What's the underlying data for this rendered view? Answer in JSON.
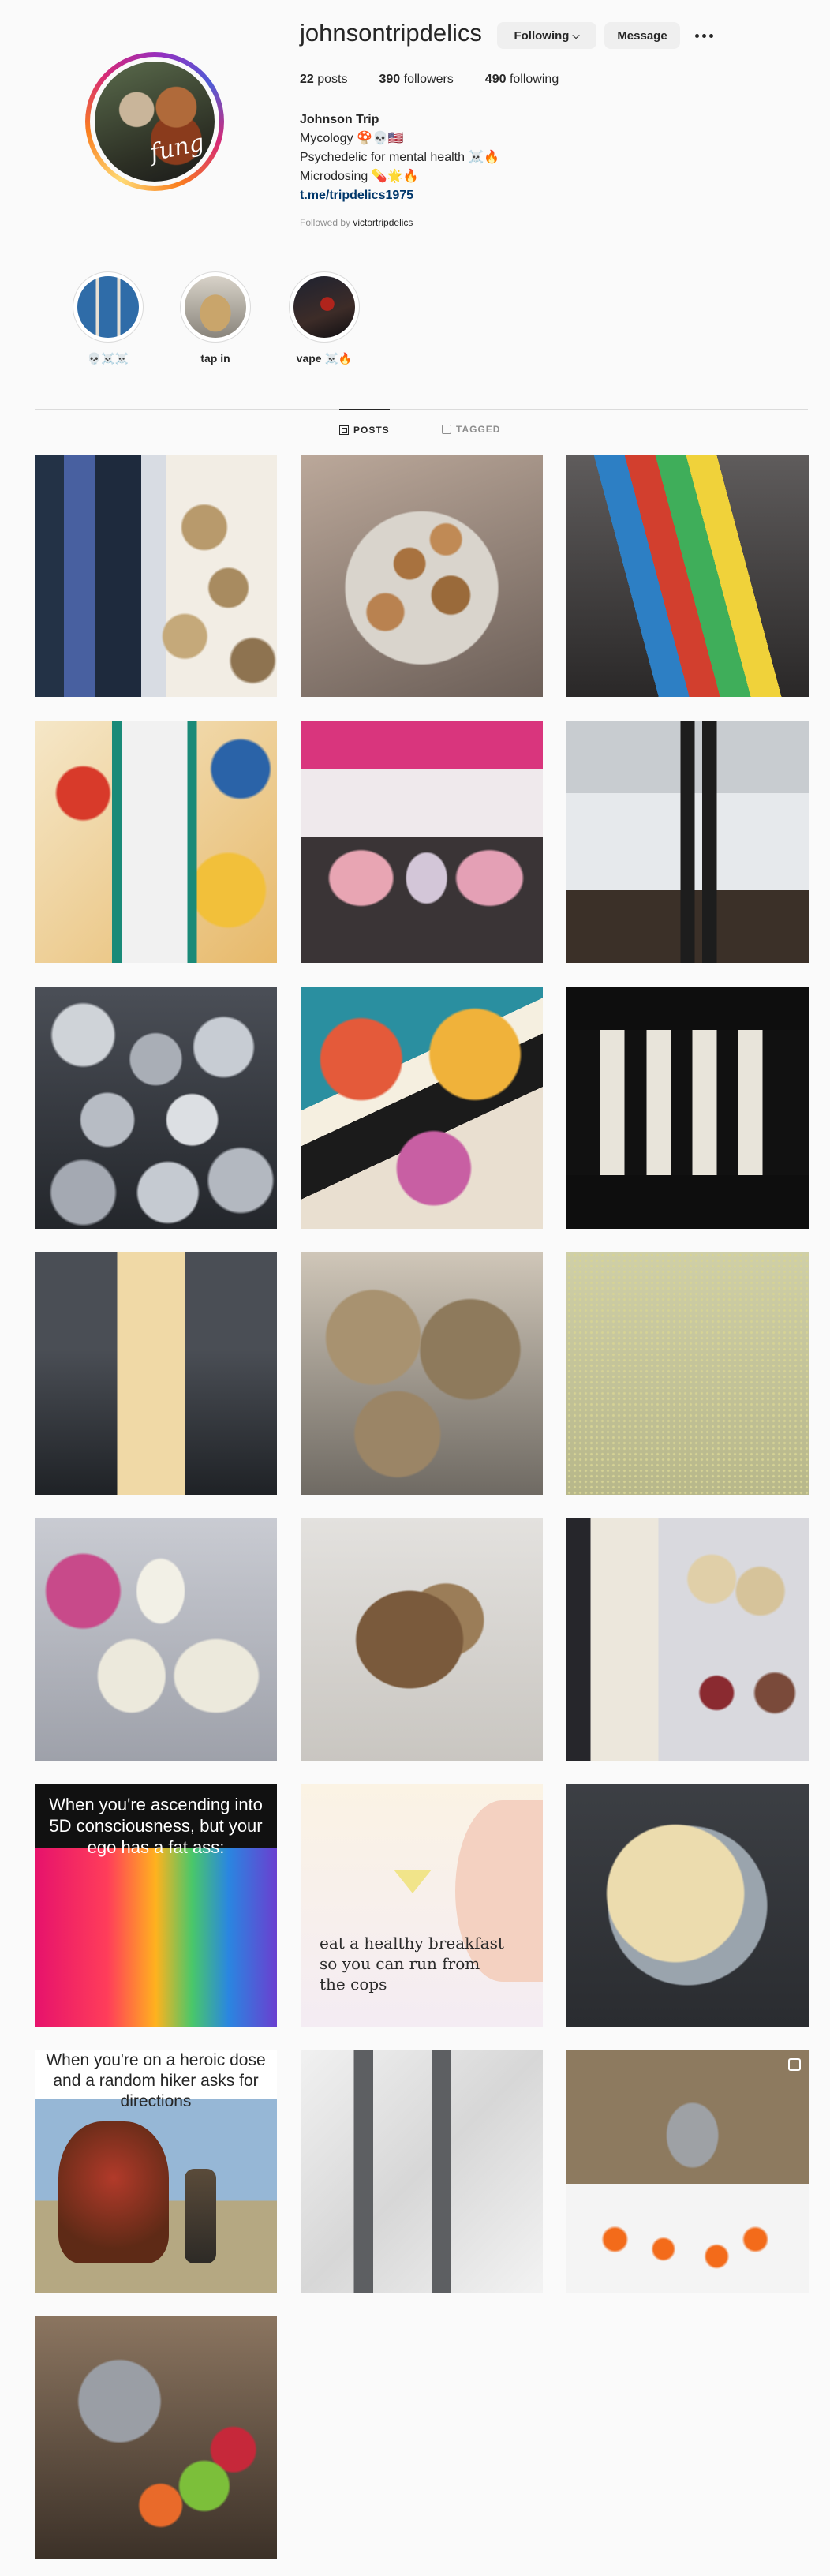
{
  "profile": {
    "username": "johnsontripdelics",
    "following_button": "Following",
    "message_button": "Message",
    "posts_count": "22",
    "posts_label": "posts",
    "followers_count": "390",
    "followers_label": "followers",
    "following_count": "490",
    "following_label": "following",
    "display_name": "Johnson Trip",
    "bio_lines": [
      "Mycology 🍄💀🇺🇸",
      "Psychedelic for mental health ☠️🔥",
      "Microdosing 💊🌟🔥"
    ],
    "link": "t.me/tripdelics1975",
    "followed_by_prefix": "Followed by",
    "followed_by_user": "victortripdelics",
    "avatar_text": "fung"
  },
  "highlights": [
    {
      "label": "💀☠️☠️"
    },
    {
      "label": "tap in"
    },
    {
      "label": "vape ☠️🔥"
    }
  ],
  "tabs": [
    {
      "label": "POSTS",
      "active": true
    },
    {
      "label": "TAGGED",
      "active": false
    }
  ],
  "posts": [
    {
      "caption": ""
    },
    {
      "caption": ""
    },
    {
      "caption": ""
    },
    {
      "caption": ""
    },
    {
      "caption": ""
    },
    {
      "caption": ""
    },
    {
      "caption": ""
    },
    {
      "caption": ""
    },
    {
      "caption": ""
    },
    {
      "caption": ""
    },
    {
      "caption": ""
    },
    {
      "caption": ""
    },
    {
      "caption": ""
    },
    {
      "caption": ""
    },
    {
      "caption": ""
    },
    {
      "caption": "When you're ascending into 5D consciousness, but your ego has a fat ass:"
    },
    {
      "caption": "eat a healthy breakfast so you can run from the cops"
    },
    {
      "caption": ""
    },
    {
      "caption": "When you're on a heroic dose and a random hiker asks for directions"
    },
    {
      "caption": ""
    },
    {
      "caption": ""
    },
    {
      "caption": ""
    }
  ],
  "colors": {
    "link": "#00376b",
    "button_bg": "#efefef",
    "background": "#fafafa",
    "muted": "#8e8e8e"
  }
}
